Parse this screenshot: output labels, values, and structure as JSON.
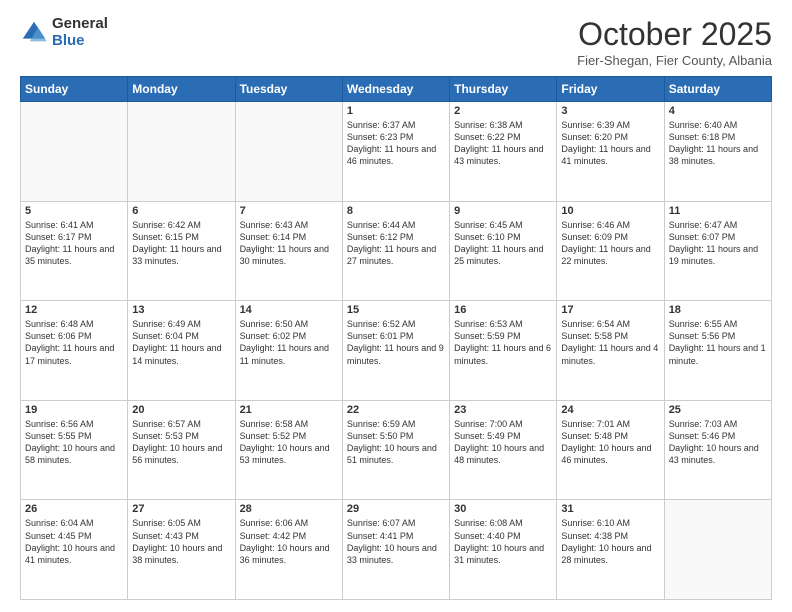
{
  "logo": {
    "general": "General",
    "blue": "Blue"
  },
  "header": {
    "month": "October 2025",
    "location": "Fier-Shegan, Fier County, Albania"
  },
  "days_of_week": [
    "Sunday",
    "Monday",
    "Tuesday",
    "Wednesday",
    "Thursday",
    "Friday",
    "Saturday"
  ],
  "weeks": [
    [
      {
        "day": "",
        "info": ""
      },
      {
        "day": "",
        "info": ""
      },
      {
        "day": "",
        "info": ""
      },
      {
        "day": "1",
        "info": "Sunrise: 6:37 AM\nSunset: 6:23 PM\nDaylight: 11 hours and 46 minutes."
      },
      {
        "day": "2",
        "info": "Sunrise: 6:38 AM\nSunset: 6:22 PM\nDaylight: 11 hours and 43 minutes."
      },
      {
        "day": "3",
        "info": "Sunrise: 6:39 AM\nSunset: 6:20 PM\nDaylight: 11 hours and 41 minutes."
      },
      {
        "day": "4",
        "info": "Sunrise: 6:40 AM\nSunset: 6:18 PM\nDaylight: 11 hours and 38 minutes."
      }
    ],
    [
      {
        "day": "5",
        "info": "Sunrise: 6:41 AM\nSunset: 6:17 PM\nDaylight: 11 hours and 35 minutes."
      },
      {
        "day": "6",
        "info": "Sunrise: 6:42 AM\nSunset: 6:15 PM\nDaylight: 11 hours and 33 minutes."
      },
      {
        "day": "7",
        "info": "Sunrise: 6:43 AM\nSunset: 6:14 PM\nDaylight: 11 hours and 30 minutes."
      },
      {
        "day": "8",
        "info": "Sunrise: 6:44 AM\nSunset: 6:12 PM\nDaylight: 11 hours and 27 minutes."
      },
      {
        "day": "9",
        "info": "Sunrise: 6:45 AM\nSunset: 6:10 PM\nDaylight: 11 hours and 25 minutes."
      },
      {
        "day": "10",
        "info": "Sunrise: 6:46 AM\nSunset: 6:09 PM\nDaylight: 11 hours and 22 minutes."
      },
      {
        "day": "11",
        "info": "Sunrise: 6:47 AM\nSunset: 6:07 PM\nDaylight: 11 hours and 19 minutes."
      }
    ],
    [
      {
        "day": "12",
        "info": "Sunrise: 6:48 AM\nSunset: 6:06 PM\nDaylight: 11 hours and 17 minutes."
      },
      {
        "day": "13",
        "info": "Sunrise: 6:49 AM\nSunset: 6:04 PM\nDaylight: 11 hours and 14 minutes."
      },
      {
        "day": "14",
        "info": "Sunrise: 6:50 AM\nSunset: 6:02 PM\nDaylight: 11 hours and 11 minutes."
      },
      {
        "day": "15",
        "info": "Sunrise: 6:52 AM\nSunset: 6:01 PM\nDaylight: 11 hours and 9 minutes."
      },
      {
        "day": "16",
        "info": "Sunrise: 6:53 AM\nSunset: 5:59 PM\nDaylight: 11 hours and 6 minutes."
      },
      {
        "day": "17",
        "info": "Sunrise: 6:54 AM\nSunset: 5:58 PM\nDaylight: 11 hours and 4 minutes."
      },
      {
        "day": "18",
        "info": "Sunrise: 6:55 AM\nSunset: 5:56 PM\nDaylight: 11 hours and 1 minute."
      }
    ],
    [
      {
        "day": "19",
        "info": "Sunrise: 6:56 AM\nSunset: 5:55 PM\nDaylight: 10 hours and 58 minutes."
      },
      {
        "day": "20",
        "info": "Sunrise: 6:57 AM\nSunset: 5:53 PM\nDaylight: 10 hours and 56 minutes."
      },
      {
        "day": "21",
        "info": "Sunrise: 6:58 AM\nSunset: 5:52 PM\nDaylight: 10 hours and 53 minutes."
      },
      {
        "day": "22",
        "info": "Sunrise: 6:59 AM\nSunset: 5:50 PM\nDaylight: 10 hours and 51 minutes."
      },
      {
        "day": "23",
        "info": "Sunrise: 7:00 AM\nSunset: 5:49 PM\nDaylight: 10 hours and 48 minutes."
      },
      {
        "day": "24",
        "info": "Sunrise: 7:01 AM\nSunset: 5:48 PM\nDaylight: 10 hours and 46 minutes."
      },
      {
        "day": "25",
        "info": "Sunrise: 7:03 AM\nSunset: 5:46 PM\nDaylight: 10 hours and 43 minutes."
      }
    ],
    [
      {
        "day": "26",
        "info": "Sunrise: 6:04 AM\nSunset: 4:45 PM\nDaylight: 10 hours and 41 minutes."
      },
      {
        "day": "27",
        "info": "Sunrise: 6:05 AM\nSunset: 4:43 PM\nDaylight: 10 hours and 38 minutes."
      },
      {
        "day": "28",
        "info": "Sunrise: 6:06 AM\nSunset: 4:42 PM\nDaylight: 10 hours and 36 minutes."
      },
      {
        "day": "29",
        "info": "Sunrise: 6:07 AM\nSunset: 4:41 PM\nDaylight: 10 hours and 33 minutes."
      },
      {
        "day": "30",
        "info": "Sunrise: 6:08 AM\nSunset: 4:40 PM\nDaylight: 10 hours and 31 minutes."
      },
      {
        "day": "31",
        "info": "Sunrise: 6:10 AM\nSunset: 4:38 PM\nDaylight: 10 hours and 28 minutes."
      },
      {
        "day": "",
        "info": ""
      }
    ]
  ]
}
